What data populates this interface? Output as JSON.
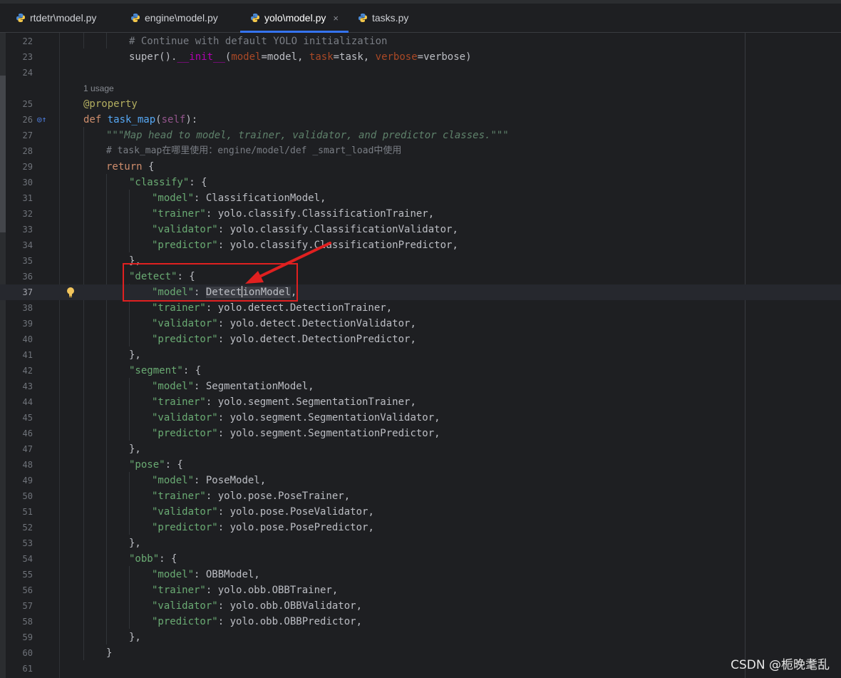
{
  "tabs": [
    {
      "label": "rtdetr\\model.py",
      "active": false
    },
    {
      "label": "engine\\model.py",
      "active": false
    },
    {
      "label": "yolo\\model.py",
      "active": true
    },
    {
      "label": "tasks.py",
      "active": false
    }
  ],
  "tab_close_glyph": "×",
  "usage_hint": "1 usage",
  "line_numbers": [
    "22",
    "23",
    "24",
    "25",
    "26",
    "27",
    "28",
    "29",
    "30",
    "31",
    "32",
    "33",
    "34",
    "35",
    "36",
    "37",
    "38",
    "39",
    "40",
    "41",
    "42",
    "43",
    "44",
    "45",
    "46",
    "47",
    "48",
    "49",
    "50",
    "51",
    "52",
    "53",
    "54",
    "55",
    "56",
    "57",
    "58",
    "59",
    "60",
    "61"
  ],
  "code": {
    "l22": "# Continue with default YOLO initialization",
    "l23_a": "super().",
    "l23_b": "__init__",
    "l23_c": "(",
    "l23_d": "model",
    "l23_e": "=model, ",
    "l23_f": "task",
    "l23_g": "=task, ",
    "l23_h": "verbose",
    "l23_i": "=verbose)",
    "l25": "@property",
    "l26_kw": "def ",
    "l26_fn": "task_map",
    "l26_a": "(",
    "l26_self": "self",
    "l26_b": "):",
    "l27": "\"\"\"Map head to model, trainer, validator, and predictor classes.\"\"\"",
    "l28": "# task_map在哪里使用：engine/model/def _smart_load中使用",
    "l29_kw": "return",
    "l29_b": " {",
    "tasks": [
      {
        "key": "\"classify\"",
        "model": "ClassificationModel,",
        "trainer": "yolo.classify.ClassificationTrainer,",
        "validator": "yolo.classify.ClassificationValidator,",
        "predictor": "yolo.classify.ClassificationPredictor,"
      },
      {
        "key": "\"detect\"",
        "model": "DetectionModel",
        "trainer": "yolo.detect.DetectionTrainer,",
        "validator": "yolo.detect.DetectionValidator,",
        "predictor": "yolo.detect.DetectionPredictor,"
      },
      {
        "key": "\"segment\"",
        "model": "SegmentationModel,",
        "trainer": "yolo.segment.SegmentationTrainer,",
        "validator": "yolo.segment.SegmentationValidator,",
        "predictor": "yolo.segment.SegmentationPredictor,"
      },
      {
        "key": "\"pose\"",
        "model": "PoseModel,",
        "trainer": "yolo.pose.PoseTrainer,",
        "validator": "yolo.pose.PoseValidator,",
        "predictor": "yolo.pose.PosePredictor,"
      },
      {
        "key": "\"obb\"",
        "model": "OBBModel,",
        "trainer": "yolo.obb.OBBTrainer,",
        "validator": "yolo.obb.OBBValidator,",
        "predictor": "yolo.obb.OBBPredictor,"
      }
    ],
    "k_model": "\"model\"",
    "k_trainer": "\"trainer\"",
    "k_validator": "\"validator\"",
    "k_predictor": "\"predictor\"",
    "colon_space": ": ",
    "open_brace": ": {",
    "close_dict": "},",
    "close_return": "}",
    "detect_model_a": "Detect",
    "detect_model_b": "ionModel",
    "detect_model_c": ","
  },
  "watermark": "CSDN @栀晚耄乱"
}
